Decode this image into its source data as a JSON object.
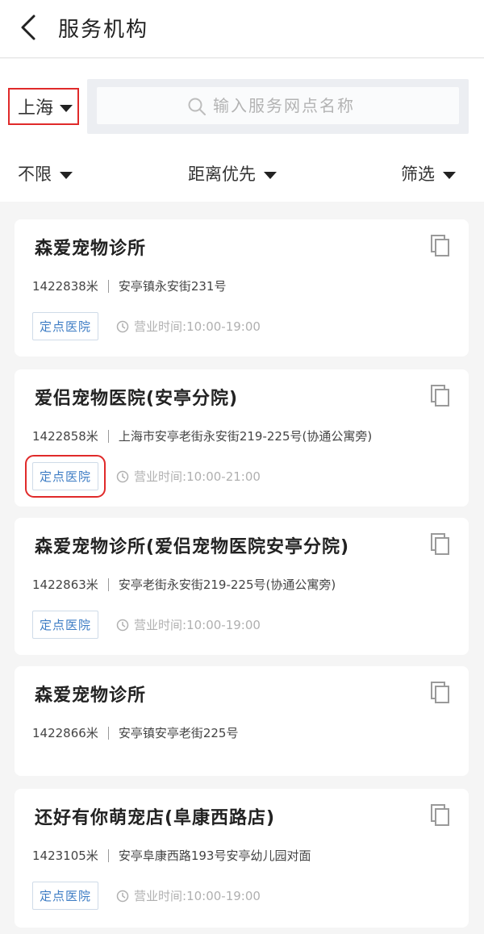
{
  "header": {
    "title": "服务机构",
    "back_icon": "chevron-left-icon"
  },
  "search": {
    "city": "上海",
    "placeholder": "输入服务网点名称"
  },
  "filters": {
    "unlimited": "不限",
    "distance": "距离优先",
    "screen": "筛选"
  },
  "highlight_color": "#e02a2a",
  "tag_color": "#3d7cc4",
  "institutions": [
    {
      "name": "森爱宠物诊所",
      "distance": "1422838米",
      "address": "安亭镇永安街231号",
      "tag": "定点医院",
      "hours": "营业时间:10:00-19:00"
    },
    {
      "name": "爱侣宠物医院(安亭分院)",
      "distance": "1422858米",
      "address": "上海市安亭老街永安街219-225号(协通公寓旁)",
      "tag": "定点医院",
      "hours": "营业时间:10:00-21:00"
    },
    {
      "name": "森爱宠物诊所(爱侣宠物医院安亭分院)",
      "distance": "1422863米",
      "address": "安亭老街永安街219-225号(协通公寓旁)",
      "tag": "定点医院",
      "hours": "营业时间:10:00-19:00"
    },
    {
      "name": "森爱宠物诊所",
      "distance": "1422866米",
      "address": "安亭镇安亭老街225号"
    },
    {
      "name": "还好有你萌宠店(阜康西路店)",
      "distance": "1423105米",
      "address": "安亭阜康西路193号安亭幼儿园对面",
      "tag": "定点医院",
      "hours": "营业时间:10:00-19:00"
    }
  ]
}
